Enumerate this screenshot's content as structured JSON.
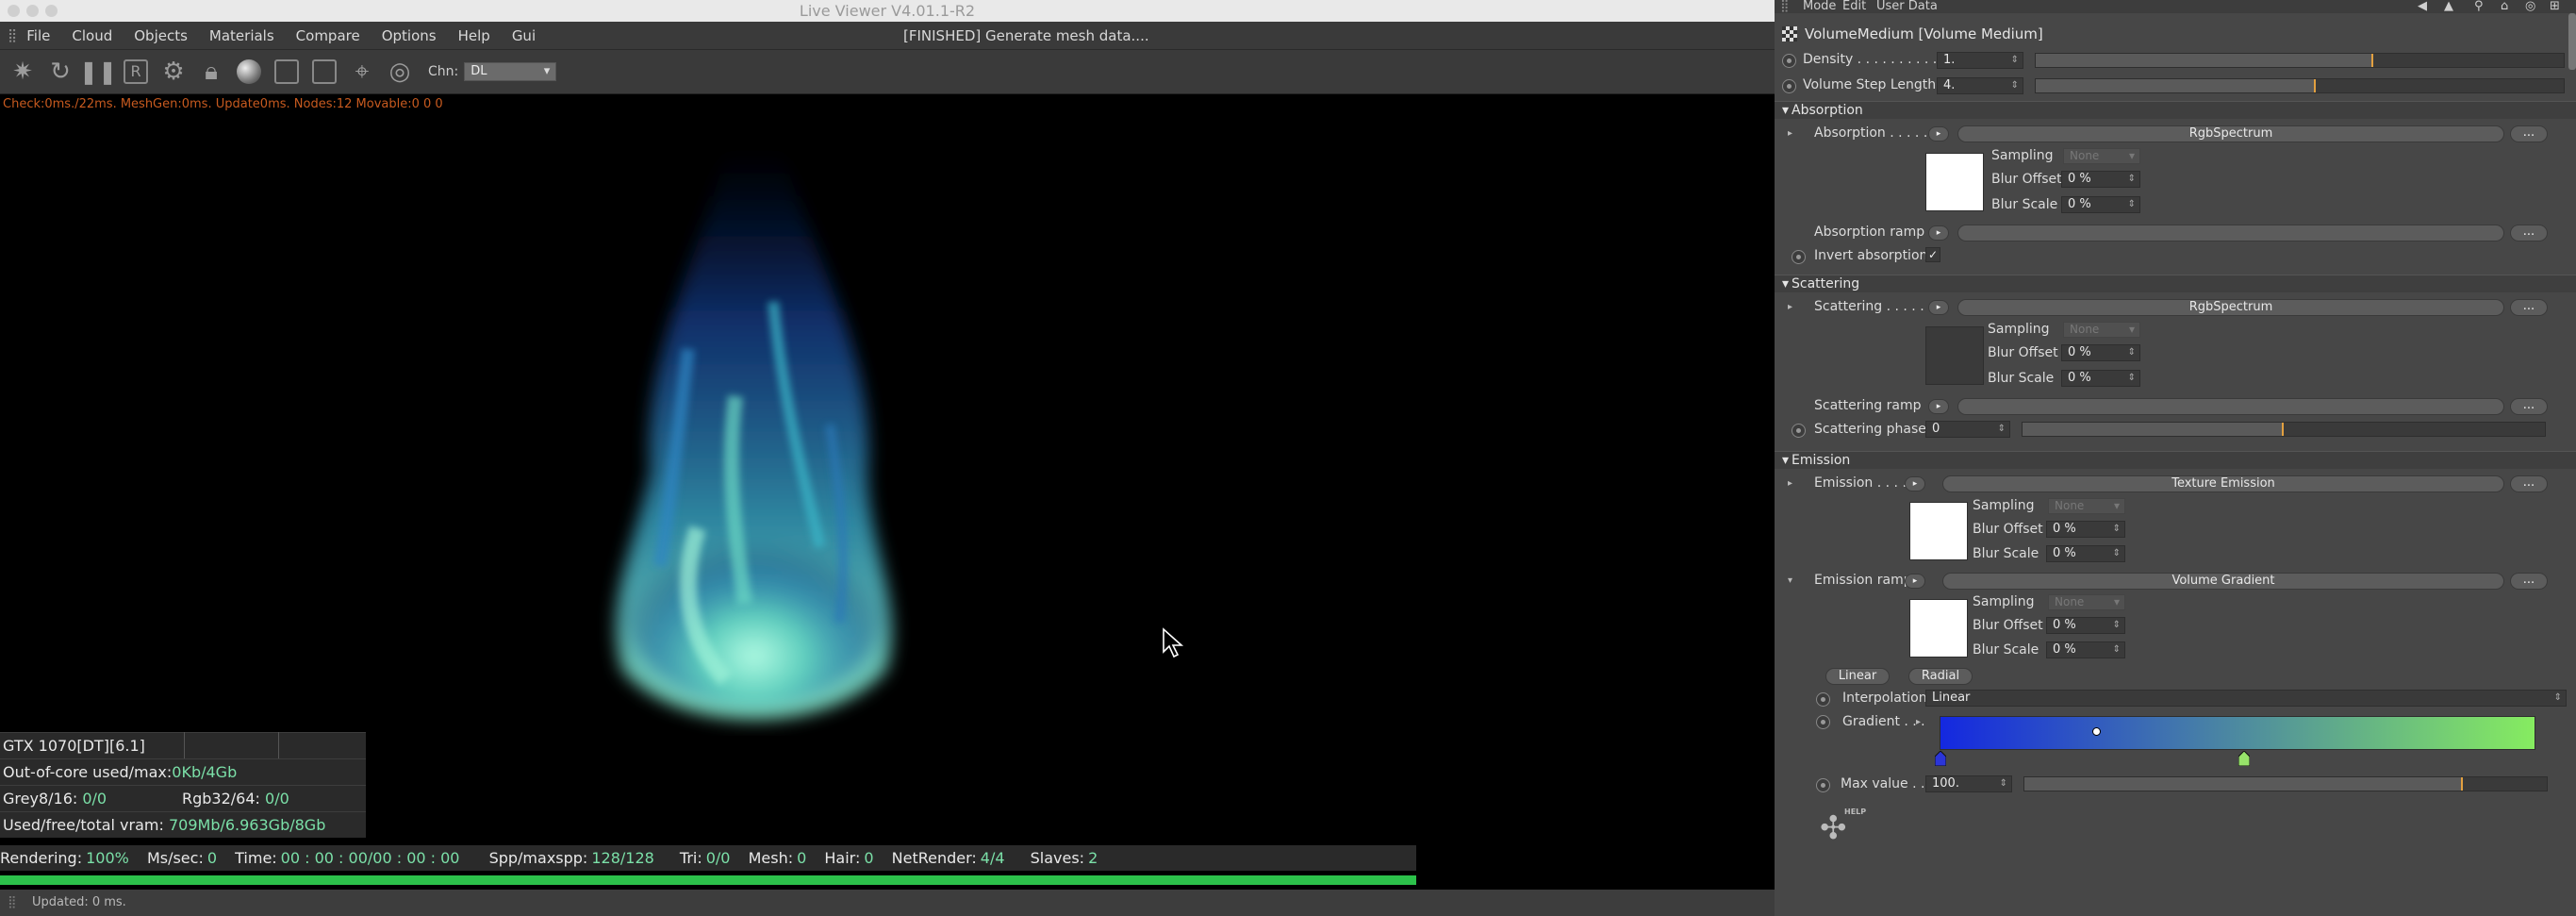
{
  "window": {
    "title": "Live Viewer V4.01.1-R2",
    "render_status": "[FINISHED] Generate mesh data...."
  },
  "menu": [
    "File",
    "Cloud",
    "Objects",
    "Materials",
    "Compare",
    "Options",
    "Help",
    "Gui"
  ],
  "toolbar": {
    "icons": [
      "render-settings-icon",
      "refresh-icon",
      "pause-icon",
      "region-render-icon",
      "settings-gear-icon",
      "material-ball-icon",
      "lock-icon",
      "clay-mode-icon",
      "sub-sampling-icon",
      "pick-focus-icon",
      "pick-material-icon"
    ],
    "channel_label": "Chn:",
    "channel_value": "DL"
  },
  "check_line": "Check:0ms./22ms. MeshGen:0ms. Update0ms. Nodes:12 Movable:0  0 0",
  "stats": {
    "gpu": "GTX 1070[DT][6.1]",
    "out_of_core_label": "Out-of-core used/max:",
    "out_of_core_value": "0Kb/4Gb",
    "grey_label": "Grey8/16:",
    "grey_value": "0/0",
    "rgb_label": "Rgb32/64:",
    "rgb_value": "0/0",
    "vram_label": "Used/free/total vram:",
    "vram_value": "709Mb/6.963Gb/8Gb"
  },
  "render_bar": {
    "rendering_label": "Rendering:",
    "rendering_value": "100%",
    "ms_label": "Ms/sec:",
    "ms_value": "0",
    "time_label": "Time:",
    "time_value": "00 : 00 : 00/00 : 00 : 00",
    "spp_label": "Spp/maxspp:",
    "spp_value": "128/128",
    "tri_label": "Tri:",
    "tri_value": "0/0",
    "mesh_label": "Mesh:",
    "mesh_value": "0",
    "hair_label": "Hair:",
    "hair_value": "0",
    "netrender_label": "NetRender:",
    "netrender_value": "4/4",
    "slaves_label": "Slaves:",
    "slaves_value": "2",
    "progress": 1.0
  },
  "bottom_status": "Updated: 0 ms.",
  "panel": {
    "top_menu": [
      "Mode",
      "Edit",
      "User Data"
    ],
    "header": "VolumeMedium [Volume Medium]",
    "density_label": "Density . . . . . . . . . . .",
    "density_value": "1.",
    "density_level": 0.64,
    "step_label": "Volume Step Length",
    "step_value": "4.",
    "step_level": 0.53,
    "absorption": {
      "section": "Absorption",
      "label": "Absorption . . . . .",
      "shader": "RgbSpectrum",
      "sampling_label": "Sampling",
      "sampling_value": "None",
      "blur_offset_label": "Blur Offset",
      "blur_offset_value": "0 %",
      "blur_scale_label": "Blur Scale",
      "blur_scale_value": "0 %",
      "ramp_label": "Absorption ramp",
      "invert_label": "Invert absorption",
      "invert_check": "✓",
      "swatch": "#ffffff"
    },
    "scattering": {
      "section": "Scattering",
      "label": "Scattering . . . . .",
      "shader": "RgbSpectrum",
      "sampling_label": "Sampling",
      "sampling_value": "None",
      "blur_offset_label": "Blur Offset",
      "blur_offset_value": "0 %",
      "blur_scale_label": "Blur Scale",
      "blur_scale_value": "0 %",
      "ramp_label": "Scattering ramp",
      "phase_label": "Scattering phase",
      "phase_value": "0",
      "phase_level": 0.5,
      "swatch": "#3a3a3a"
    },
    "emission": {
      "section": "Emission",
      "label": "Emission . . . . .",
      "shader": "Texture Emission",
      "sampling_label": "Sampling",
      "sampling_value": "None",
      "blur_offset_label": "Blur Offset",
      "blur_offset_value": "0 %",
      "blur_scale_label": "Blur Scale",
      "blur_scale_value": "0 %",
      "ramp_label": "Emission ramp",
      "ramp_shader": "Volume Gradient",
      "ramp_sampling_label": "Sampling",
      "ramp_sampling_value": "None",
      "ramp_blur_offset_label": "Blur Offset",
      "ramp_blur_offset_value": "0 %",
      "ramp_blur_scale_label": "Blur Scale",
      "ramp_blur_scale_value": "0 %",
      "linear_button": "Linear",
      "radial_button": "Radial",
      "interpolation_label": "Interpolation",
      "interpolation_value": "Linear",
      "gradient_label": "Gradient . . .",
      "gradient_start": "#1428e0",
      "gradient_end": "#86ec60",
      "max_label": "Max value . .",
      "max_value": "100.",
      "max_level": 0.84,
      "swatch": "#ffffff"
    },
    "help_label": "HELP"
  },
  "colors": {
    "accent_green": "#7be0a8",
    "progress_green": "#2cc14a",
    "slider_marker": "#e2a040",
    "check_orange": "#c75a1f"
  }
}
